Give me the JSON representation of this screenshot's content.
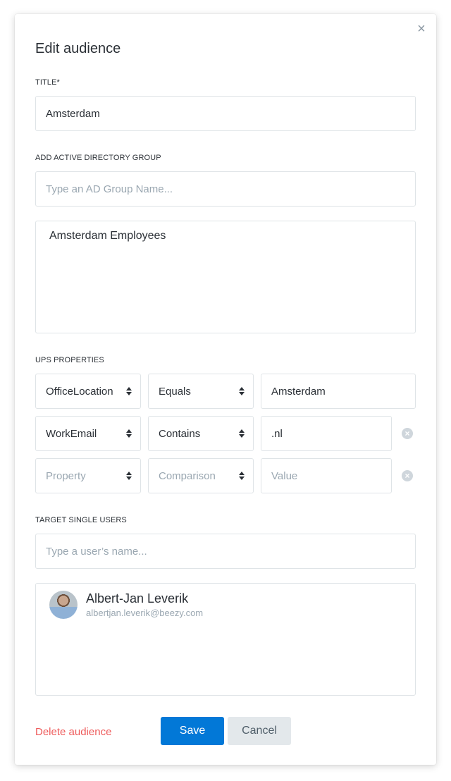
{
  "dialog": {
    "title": "Edit audience",
    "close_icon": "close-icon"
  },
  "title_field": {
    "label": "TITLE*",
    "value": "Amsterdam"
  },
  "ad_group": {
    "label": "ADD ACTIVE DIRECTORY GROUP",
    "placeholder": "Type an AD Group Name...",
    "selected": [
      "Amsterdam Employees"
    ]
  },
  "ups_properties": {
    "label": "UPS PROPERTIES",
    "rows": [
      {
        "property": "OfficeLocation",
        "comparison": "Equals",
        "value": "Amsterdam",
        "removable": false
      },
      {
        "property": "WorkEmail",
        "comparison": "Contains",
        "value": ".nl",
        "removable": true
      },
      {
        "property": "",
        "comparison": "",
        "value": "",
        "removable": true
      }
    ],
    "placeholders": {
      "property": "Property",
      "comparison": "Comparison",
      "value": "Value"
    }
  },
  "single_users": {
    "label": "TARGET SINGLE USERS",
    "placeholder": "Type a user’s name...",
    "selected": [
      {
        "name": "Albert-Jan Leverik",
        "email": "albertjan.leverik@beezy.com"
      }
    ]
  },
  "footer": {
    "delete_label": "Delete audience",
    "save_label": "Save",
    "cancel_label": "Cancel"
  },
  "colors": {
    "primary": "#0278d7",
    "danger": "#ee5a5a",
    "secondary_bg": "#e3e8eb"
  }
}
